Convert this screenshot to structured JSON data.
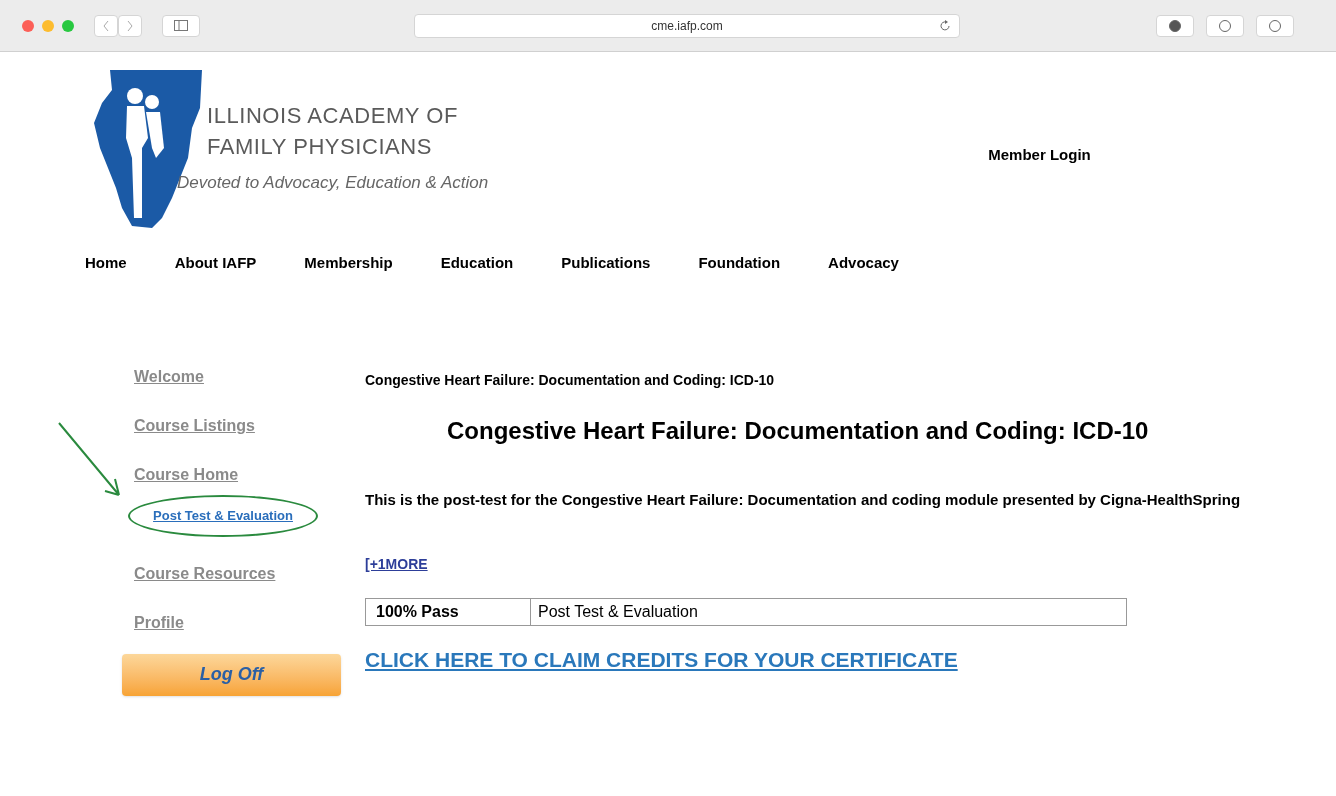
{
  "browser": {
    "url": "cme.iafp.com"
  },
  "logo": {
    "line_1": "ILLINOIS ACADEMY OF",
    "line_2": "FAMILY PHYSICIANS",
    "tagline": "Devoted to Advocacy, Education & Action"
  },
  "member_login": "Member Login",
  "nav": [
    "Home",
    "About IAFP",
    "Membership",
    "Education",
    "Publications",
    "Foundation",
    "Advocacy"
  ],
  "sidebar": {
    "items": [
      {
        "label": "Welcome",
        "selected": false
      },
      {
        "label": "Course Listings",
        "selected": false
      },
      {
        "label": "Course Home",
        "selected": false,
        "children": [
          {
            "label": "Post Test & Evaluation",
            "selected": true,
            "highlighted": true
          }
        ]
      },
      {
        "label": "Course Resources",
        "selected": false
      },
      {
        "label": "Profile",
        "selected": false
      }
    ],
    "logoff": "Log Off"
  },
  "main": {
    "breadcrumb": "Congestive Heart Failure: Documentation and Coding: ICD-10",
    "title": "Congestive Heart Failure: Documentation and Coding: ICD-10",
    "description": "This is the post-test for the Congestive Heart Failure: Documentation and coding module presented by Cigna-HealthSpring",
    "more_link": "[+1MORE",
    "result": {
      "status": "100% Pass",
      "name": "Post Test & Evaluation"
    },
    "claim_link": "CLICK HERE TO CLAIM CREDITS FOR YOUR CERTIFICATE"
  }
}
